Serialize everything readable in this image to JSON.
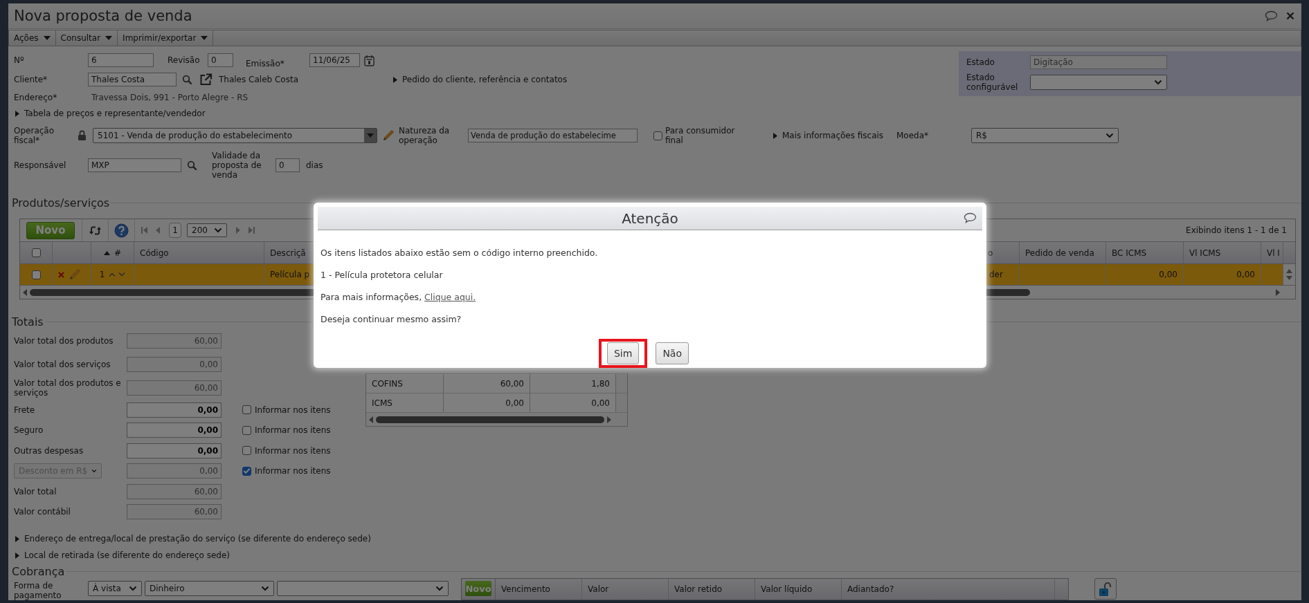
{
  "window": {
    "title": "Nova proposta de venda"
  },
  "menu": [
    {
      "label": "Ações"
    },
    {
      "label": "Consultar"
    },
    {
      "label": "Imprimir/exportar"
    }
  ],
  "header": {
    "numero": {
      "label": "Nº",
      "value": "6"
    },
    "revisao": {
      "label": "Revisão",
      "value": "0"
    },
    "emissao": {
      "label": "Emissão*",
      "value": "11/06/25"
    },
    "cliente": {
      "label": "Cliente*",
      "value": "Thales Costa",
      "name": "Thales Caleb Costa"
    },
    "pedido_link": "Pedido do cliente, referência e contatos",
    "endereco": {
      "label": "Endereço*",
      "value": "Travessa Dois, 991 - Porto Alegre - RS"
    },
    "tabela_link": "Tabela de preços e representante/vendedor",
    "operacao": {
      "label": "Operação fiscal*",
      "value": "5101 - Venda de produção do estabelecimento"
    },
    "natureza": {
      "label": "Natureza da operação",
      "value": "Venda de produção do estabelecime"
    },
    "consumidor_final": {
      "label": "Para consumidor final",
      "checked": false
    },
    "fiscais_link": "Mais informações fiscais",
    "moeda": {
      "label": "Moeda*",
      "value": "R$"
    },
    "responsavel": {
      "label": "Responsável",
      "value": "MXP"
    },
    "validade": {
      "label": "Validade da proposta de venda",
      "value": "0",
      "unit": "dias"
    },
    "estado": {
      "label": "Estado",
      "value": "Digitação"
    },
    "estado_configuravel": {
      "label": "Estado configurável"
    }
  },
  "products": {
    "legend": "Produtos/serviços",
    "new_button": "Novo",
    "page": "1",
    "page_size": "200",
    "info": "Exibindo itens 1 - 1 de 1",
    "all_checked": false,
    "columns": [
      {
        "label": "#"
      },
      {
        "label": "Código"
      },
      {
        "label": "Descriçã"
      },
      {
        "label": "o"
      },
      {
        "label": "Pedido de venda"
      },
      {
        "label": "BC ICMS"
      },
      {
        "label": "Vl ICMS"
      },
      {
        "label": "Vl I"
      }
    ],
    "rows": [
      {
        "selected": true,
        "checked": false,
        "number": "1",
        "descricao": "Película p",
        "column_4": "der",
        "bc_icms": "0,00",
        "vl_icms": "0,00"
      }
    ]
  },
  "totals": {
    "legend": "Totais",
    "rows": [
      {
        "kind": "field",
        "label": "Valor total dos produtos",
        "value": "60,00",
        "readonly": true
      },
      {
        "kind": "field",
        "label": "Valor total dos serviços",
        "value": "0,00",
        "readonly": true
      },
      {
        "kind": "field",
        "label": "Valor total dos produtos e serviços",
        "value": "60,00",
        "readonly": true
      },
      {
        "kind": "field",
        "label": "Frete",
        "value": "0,00",
        "readonly": false,
        "informar": {
          "label": "Informar nos itens",
          "checked": false
        }
      },
      {
        "kind": "field",
        "label": "Seguro",
        "value": "0,00",
        "readonly": false,
        "informar": {
          "label": "Informar nos itens",
          "checked": false
        }
      },
      {
        "kind": "field",
        "label": "Outras despesas",
        "value": "0,00",
        "readonly": false,
        "informar": {
          "label": "Informar nos itens",
          "checked": false
        }
      },
      {
        "kind": "select",
        "select": {
          "value": "Desconto em R$",
          "disabled": true
        },
        "value": "0,00",
        "readonly": true,
        "informar": {
          "label": "Informar nos itens",
          "checked": true
        }
      },
      {
        "kind": "field",
        "label": "Valor total",
        "value": "60,00",
        "readonly": true
      },
      {
        "kind": "field",
        "label": "Valor contábil",
        "value": "60,00",
        "readonly": true
      }
    ],
    "taxes": [
      {
        "tax": "COFINS",
        "column_2": "60,00",
        "column_3": "1,80"
      },
      {
        "tax": "ICMS",
        "column_2": "0,00",
        "column_3": "0,00"
      }
    ]
  },
  "expanders": [
    "Endereço de entrega/local de prestação do serviço (se diferente do endereço sede)",
    "Local de retirada (se diferente do endereço sede)"
  ],
  "cobranca": {
    "legend": "Cobrança",
    "label": "Forma de pagamento",
    "selects": [
      {
        "value": "À vista"
      },
      {
        "value": "Dinheiro"
      },
      {
        "kind": "blank"
      }
    ],
    "new_button": "Novo",
    "columns": [
      "Vencimento",
      "Valor",
      "Valor retido",
      "Valor líquido",
      "Adiantado?"
    ]
  },
  "dialog": {
    "title": "Atenção",
    "message": "Os itens listados abaixo estão sem o código interno preenchido.",
    "item": "1 - Película protetora celular",
    "info_prefix": "Para mais informações, ",
    "info_link": "Clique aqui.",
    "question": "Deseja continuar mesmo assim?",
    "buttons": [
      {
        "label": "Sim",
        "highlighted": true
      },
      {
        "label": "Não",
        "highlighted": false
      }
    ]
  }
}
